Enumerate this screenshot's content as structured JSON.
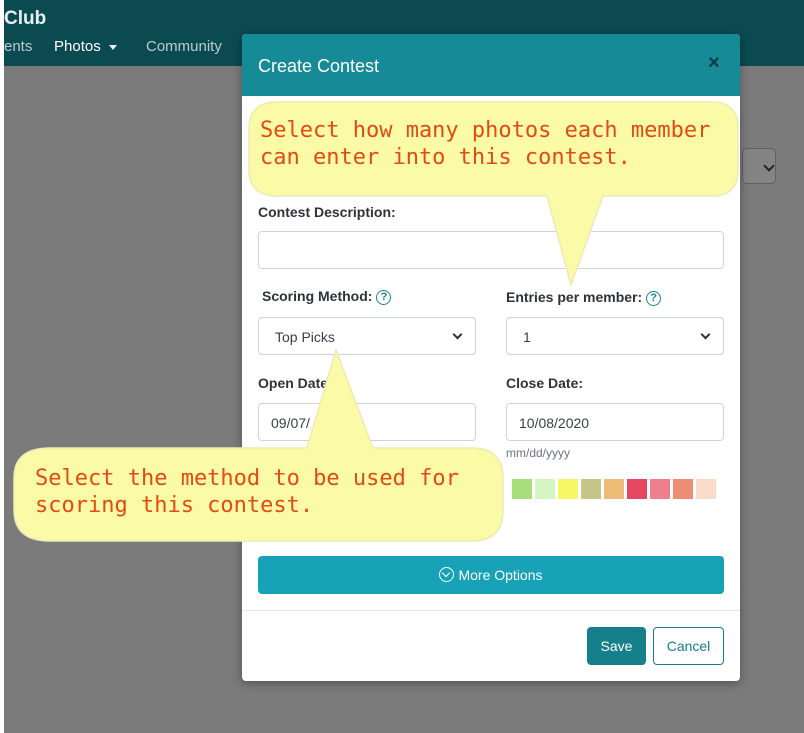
{
  "nav": {
    "brand": "Club",
    "items": [
      {
        "label": "ents"
      },
      {
        "label": "Photos"
      },
      {
        "label": "Community"
      }
    ]
  },
  "modal": {
    "title": "Create Contest",
    "close_symbol": "×",
    "fields": {
      "description_label": "Contest Description:",
      "description_value": "",
      "scoring_label": "Scoring Method:",
      "scoring_value": "Top Picks",
      "entries_label": "Entries per member:",
      "entries_value": "1",
      "open_label": "Open Date",
      "open_value": "09/07/",
      "close_label": "Close Date:",
      "close_value": "10/08/2020",
      "date_hint": "mm/dd/yyyy",
      "help_icon": "?"
    },
    "swatch_colors": [
      "#a8dd7c",
      "#d5f5c5",
      "#f7f766",
      "#c7c48a",
      "#eebb78",
      "#e54661",
      "#f07f8d",
      "#ed8e74",
      "#fbdcca"
    ],
    "more_options_label": "More Options",
    "save_label": "Save",
    "cancel_label": "Cancel"
  },
  "callouts": {
    "entries_tip": {
      "line1": "Select how many photos each member",
      "line2": "can enter into this contest."
    },
    "scoring_tip": {
      "line1": "Select the method to be used for",
      "line2": "scoring this contest."
    }
  },
  "colors": {
    "header_teal": "#168a96",
    "button_teal": "#17a2b8",
    "callout_fill": "#fbfaa6",
    "callout_text": "#e24b14"
  }
}
